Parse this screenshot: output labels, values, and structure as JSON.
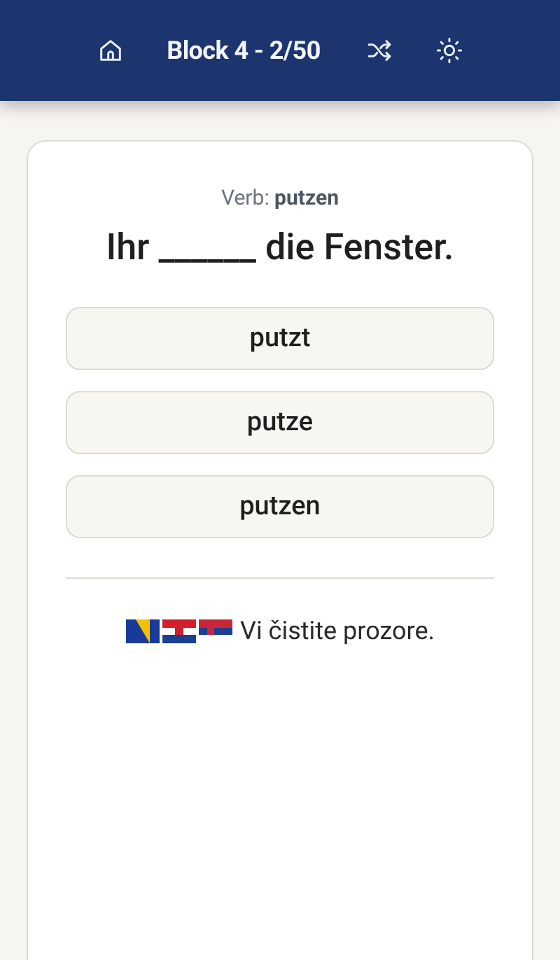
{
  "header": {
    "title": "Block 4 - 2/50"
  },
  "card": {
    "hint": "Verb: **putzen**",
    "sentence": "Ihr ______ die Fenster.",
    "options": [
      {
        "label": "putzt"
      },
      {
        "label": "putze"
      },
      {
        "label": "putzen"
      }
    ],
    "translation": "Vi čistite prozore."
  }
}
